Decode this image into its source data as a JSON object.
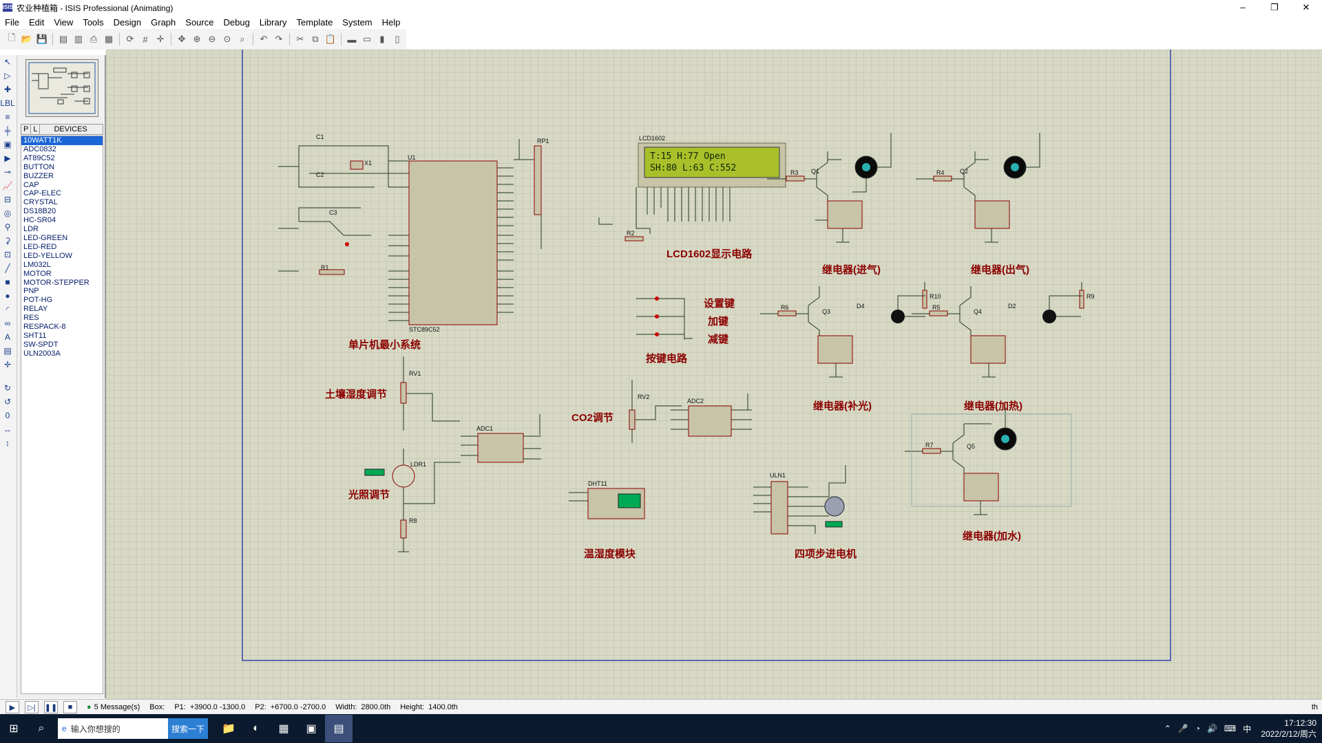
{
  "window": {
    "title": "农业种植箱 - ISIS Professional (Animating)",
    "app_icon": "ISIS",
    "min": "–",
    "max": "❐",
    "close": "✕"
  },
  "menu": [
    "File",
    "Edit",
    "View",
    "Tools",
    "Design",
    "Graph",
    "Source",
    "Debug",
    "Library",
    "Template",
    "System",
    "Help"
  ],
  "device_panel": {
    "tab_p": "P",
    "tab_l": "L",
    "tab_devices": "DEVICES",
    "items": [
      "10WATT1K",
      "ADC0832",
      "AT89C52",
      "BUTTON",
      "BUZZER",
      "CAP",
      "CAP-ELEC",
      "CRYSTAL",
      "DS18B20",
      "HC-SR04",
      "LDR",
      "LED-GREEN",
      "LED-RED",
      "LED-YELLOW",
      "LM032L",
      "MOTOR",
      "MOTOR-STEPPER",
      "PNP",
      "POT-HG",
      "RELAY",
      "RES",
      "RESPACK-8",
      "SHT11",
      "SW-SPDT",
      "ULN2003A"
    ],
    "selected_index": 0
  },
  "rotation_value": "0",
  "schematic": {
    "lcd_line1": "T:15 H:77  Open",
    "lcd_line2": "SH:80 L:63 C:552",
    "labels": {
      "mcu_system": "单片机最小系统",
      "lcd_circuit": "LCD1602显示电路",
      "key_circuit": "按键电路",
      "set_key": "设置键",
      "add_key": "加键",
      "sub_key": "减键",
      "soil": "土壤湿度调节",
      "light": "光照调节",
      "co2": "CO2调节",
      "dht": "温湿度模块",
      "stepper": "四项步进电机",
      "relay_in": "继电器(进气)",
      "relay_out": "继电器(出气)",
      "relay_light": "继电器(补光)",
      "relay_heat": "继电器(加热)",
      "relay_water": "继电器(加水)"
    },
    "refs": {
      "lcd": "LCD1602",
      "u1": "U1",
      "mcu_part": "STC89C52",
      "rp1": "RP1",
      "c1": "C1",
      "c2": "C2",
      "c3": "C3",
      "x1": "X1",
      "r1": "R1",
      "r2": "R2",
      "r3": "R3",
      "r4": "R4",
      "r5": "R5",
      "r6": "R6",
      "r7": "R7",
      "r8": "R8",
      "r9": "R9",
      "r10": "R10",
      "q1": "Q1",
      "q2": "Q2",
      "q3": "Q3",
      "q4": "Q4",
      "q5": "Q5",
      "d2": "D2",
      "d4": "D4",
      "rv1": "RV1",
      "rv2": "RV2",
      "adc1": "ADC1",
      "adc2": "ADC2",
      "ldr1": "LDR1",
      "dht11": "DHT11",
      "uln1": "ULN1"
    }
  },
  "status": {
    "messages": "5 Message(s)",
    "box": "Box:",
    "p1_label": "P1:",
    "p1": "+3900.0  -1300.0",
    "p2_label": "P2:",
    "p2": "+6700.0  -2700.0",
    "width_label": "Width:",
    "width": "2800.0th",
    "height_label": "Height:",
    "height": "1400.0th",
    "unit": "th"
  },
  "taskbar": {
    "search_placeholder": "输入你想搜的",
    "search_button": "搜索一下",
    "ime": "中",
    "time": "17:12:30",
    "date": "2022/2/12/周六"
  }
}
